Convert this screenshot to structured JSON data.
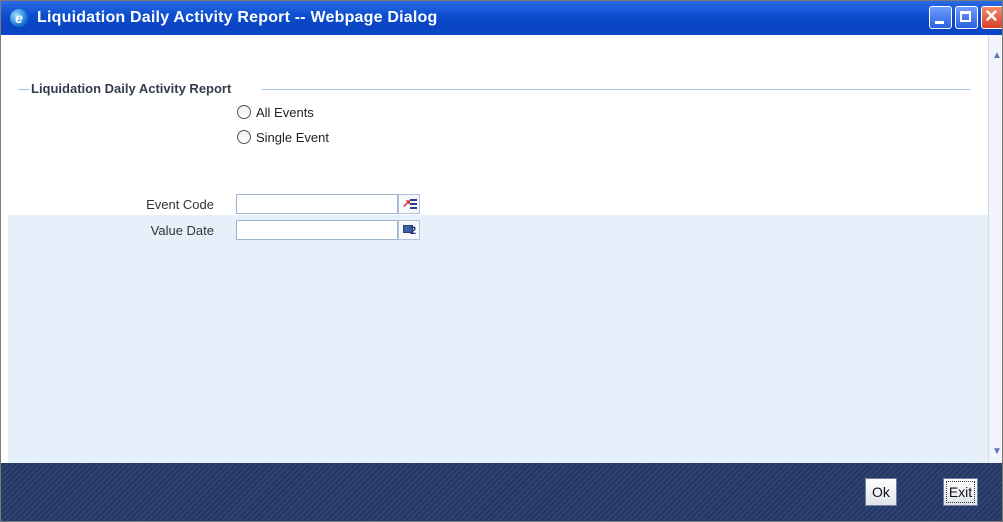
{
  "window": {
    "title": "Liquidation Daily Activity Report -- Webpage Dialog",
    "icon": "ie-icon",
    "controls": [
      "minimize",
      "maximize",
      "close"
    ]
  },
  "form": {
    "legend": "Liquidation Daily Activity Report",
    "radios": [
      {
        "label": "All Events",
        "checked": false
      },
      {
        "label": "Single Event",
        "checked": false
      }
    ],
    "event_code": {
      "label": "Event Code",
      "value": "",
      "button_icon": "list-of-values-icon"
    },
    "value_date": {
      "label": "Value Date",
      "value": "",
      "button_icon": "calendar-icon"
    }
  },
  "footer": {
    "ok_label": "Ok",
    "exit_label": "Exit"
  },
  "colors": {
    "titlebar": "#0b46c8",
    "panel": "#e5f0fb",
    "footer": "#2a3d6b"
  }
}
